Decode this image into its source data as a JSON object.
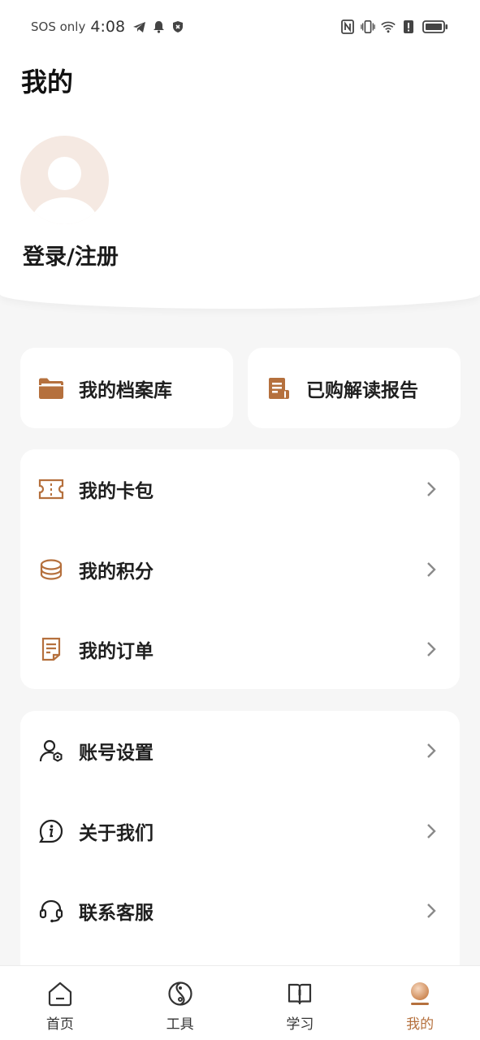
{
  "status_bar": {
    "carrier_text": "SOS only",
    "time": "4:08",
    "left_icons": [
      "telegram-icon",
      "bell-icon",
      "shield-icon"
    ],
    "right_icons": [
      "nfc-icon",
      "vibrate-icon",
      "wifi-icon",
      "alert-icon",
      "battery-icon"
    ]
  },
  "header": {
    "title": "我的",
    "login_text": "登录/注册"
  },
  "quick_actions": [
    {
      "label": "我的档案库",
      "icon": "folder-icon"
    },
    {
      "label": "已购解读报告",
      "icon": "report-icon"
    }
  ],
  "menu_group_1": [
    {
      "label": "我的卡包",
      "icon": "ticket-icon"
    },
    {
      "label": "我的积分",
      "icon": "coins-icon"
    },
    {
      "label": "我的订单",
      "icon": "order-icon"
    }
  ],
  "menu_group_2": [
    {
      "label": "账号设置",
      "icon": "user-settings-icon"
    },
    {
      "label": "关于我们",
      "icon": "info-icon"
    },
    {
      "label": "联系客服",
      "icon": "headset-icon"
    }
  ],
  "tab_bar": {
    "active": "我的",
    "tabs": [
      {
        "label": "首页",
        "icon": "home-icon"
      },
      {
        "label": "工具",
        "icon": "tools-icon"
      },
      {
        "label": "学习",
        "icon": "book-icon"
      },
      {
        "label": "我的",
        "icon": "profile-icon"
      }
    ]
  },
  "colors": {
    "accent": "#b5703d",
    "avatar_bg": "#f5e9e2",
    "background": "#f6f6f6"
  }
}
